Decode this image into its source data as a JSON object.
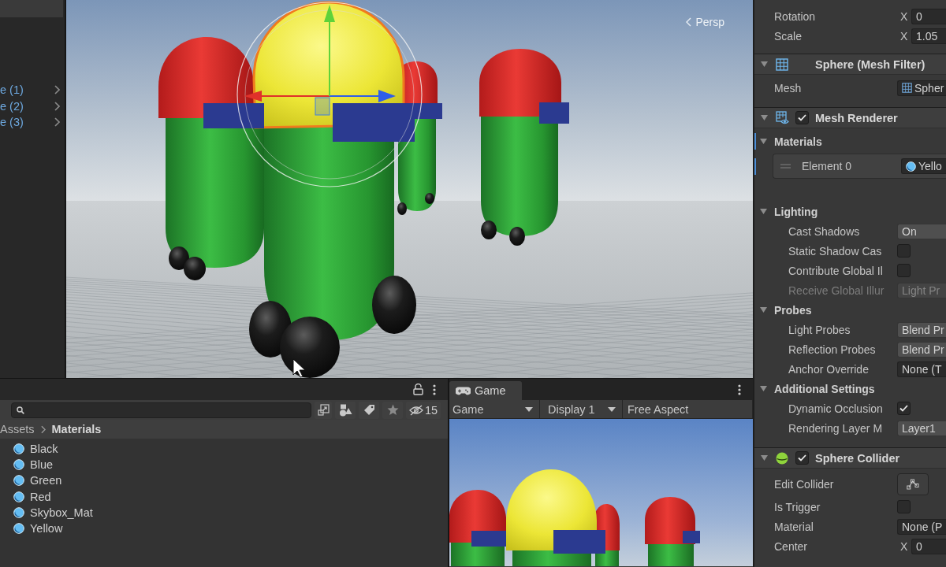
{
  "hierarchy": {
    "items": [
      {
        "label": "e (1)",
        "selected": false
      },
      {
        "label": "e (2)",
        "selected": false
      },
      {
        "label": "e (3)",
        "selected": false
      }
    ]
  },
  "scene": {
    "projection": "Persp"
  },
  "project": {
    "hidden_count": "15",
    "breadcrumb": [
      {
        "label": "Assets",
        "current": false
      },
      {
        "label": "Materials",
        "current": true
      }
    ],
    "items": [
      {
        "label": "Black",
        "selected": false
      },
      {
        "label": "Blue",
        "selected": false
      },
      {
        "label": "Green",
        "selected": false
      },
      {
        "label": "Red",
        "selected": false
      },
      {
        "label": "Skybox_Mat",
        "selected": false
      },
      {
        "label": "Yellow",
        "selected": false
      }
    ]
  },
  "game": {
    "tabs": [
      {
        "label": "Game",
        "selected": true
      }
    ],
    "toolbar": [
      {
        "kind": "dropdown",
        "label": "Game"
      },
      {
        "kind": "dropdown",
        "label": "Display 1"
      },
      {
        "kind": "aspect",
        "label": "Free Aspect"
      }
    ]
  },
  "inspector": {
    "transform": [
      {
        "kind": "vector",
        "label": "Rotation",
        "axis": "X",
        "value": "0"
      },
      {
        "kind": "vector",
        "label": "Scale",
        "axis": "X",
        "value": "1.05"
      }
    ],
    "components": [
      {
        "kind": "mesh_filter",
        "title": "Sphere (Mesh Filter)",
        "expanded": true,
        "rows": [
          {
            "kind": "mesh_object",
            "label": "Mesh",
            "value": "Spher"
          }
        ]
      },
      {
        "kind": "mesh_renderer",
        "title": "Mesh Renderer",
        "enabled": true,
        "expanded": true,
        "rows": [
          {
            "kind": "section",
            "label": "Materials",
            "expanded": true,
            "overridden": true,
            "rows": [
              {
                "kind": "element",
                "label": "Element 0",
                "value": "Yello",
                "overridden": true
              }
            ]
          },
          {
            "kind": "section",
            "label": "Lighting",
            "expanded": true,
            "overridden": false,
            "rows": [
              {
                "kind": "dropdown",
                "label": "Cast Shadows",
                "value": "On",
                "disabled": false
              },
              {
                "kind": "checkbox",
                "label": "Static Shadow Cas",
                "checked": false,
                "disabled": false
              },
              {
                "kind": "checkbox",
                "label": "Contribute Global Il",
                "checked": false,
                "disabled": false
              },
              {
                "kind": "dropdown",
                "label": "Receive Global Illur",
                "value": "Light Pr",
                "disabled": true
              }
            ]
          },
          {
            "kind": "section",
            "label": "Probes",
            "expanded": true,
            "overridden": false,
            "rows": [
              {
                "kind": "dropdown",
                "label": "Light Probes",
                "value": "Blend Pr"
              },
              {
                "kind": "dropdown",
                "label": "Reflection Probes",
                "value": "Blend Pr"
              },
              {
                "kind": "object",
                "label": "Anchor Override",
                "value": "None (T"
              }
            ]
          },
          {
            "kind": "section",
            "label": "Additional Settings",
            "expanded": true,
            "overridden": false,
            "rows": [
              {
                "kind": "checkbox",
                "label": "Dynamic Occlusion",
                "checked": true
              },
              {
                "kind": "dropdown",
                "label": "Rendering Layer M",
                "value": "Layer1"
              }
            ]
          }
        ]
      },
      {
        "kind": "sphere_collider",
        "title": "Sphere Collider",
        "enabled": true,
        "expanded": true,
        "rows": [
          {
            "kind": "button",
            "label": "Edit Collider"
          },
          {
            "kind": "checkbox",
            "label": "Is Trigger",
            "checked": false
          },
          {
            "kind": "object",
            "label": "Material",
            "value": "None (P"
          },
          {
            "kind": "vector",
            "label": "Center",
            "axis": "X",
            "value": "0"
          }
        ]
      }
    ]
  }
}
